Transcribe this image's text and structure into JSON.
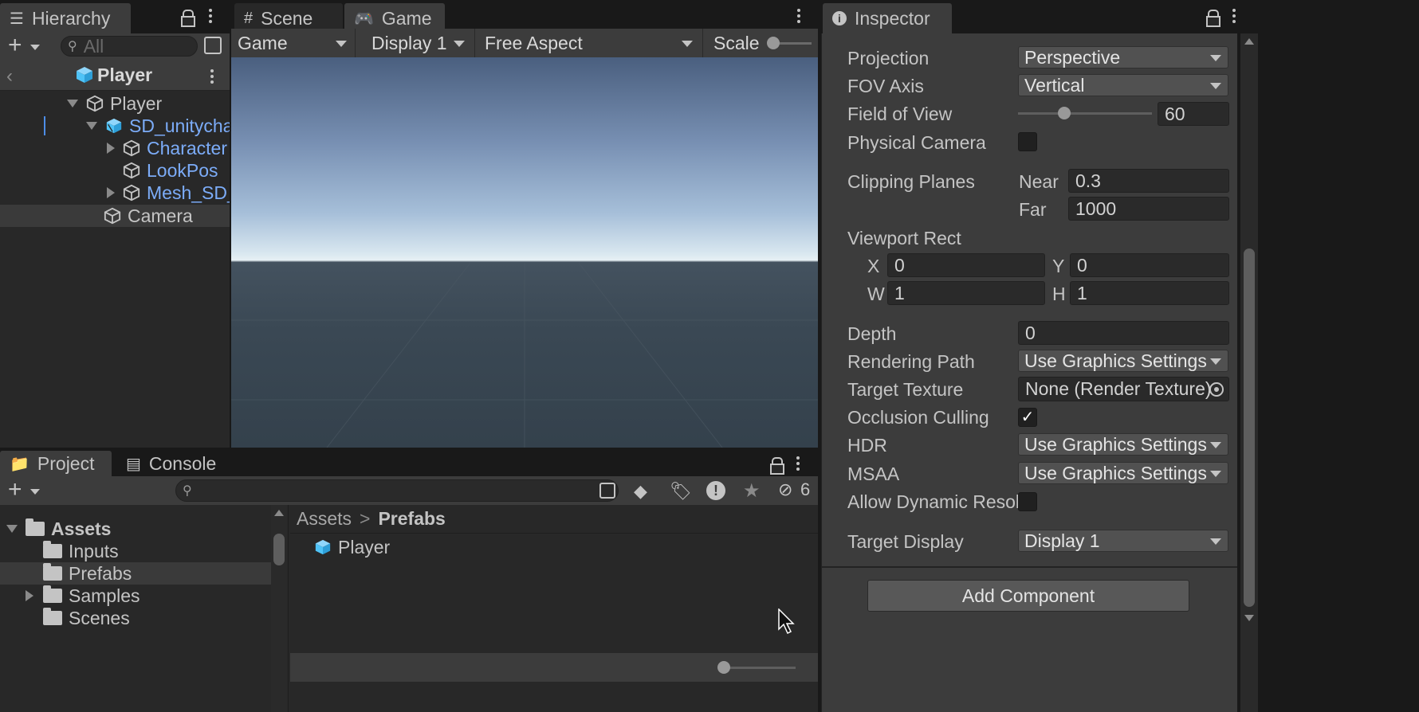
{
  "hierarchy": {
    "tab_label": "Hierarchy",
    "search_placeholder": "All",
    "prefab_header": "Player",
    "items": [
      {
        "label": "Player"
      },
      {
        "label": "SD_unitycha"
      },
      {
        "label": "Character"
      },
      {
        "label": "LookPos"
      },
      {
        "label": "Mesh_SD_"
      },
      {
        "label": "Camera"
      }
    ]
  },
  "game_view": {
    "tabs": [
      {
        "label": "Scene"
      },
      {
        "label": "Game"
      }
    ],
    "toolbar": {
      "mode": "Game",
      "display": "Display 1",
      "aspect": "Free Aspect",
      "scale_label": "Scale"
    }
  },
  "inspector": {
    "tab_label": "Inspector",
    "rows": {
      "projection": {
        "label": "Projection",
        "value": "Perspective"
      },
      "fov_axis": {
        "label": "FOV Axis",
        "value": "Vertical"
      },
      "field_of_view": {
        "label": "Field of View",
        "value": "60"
      },
      "physical_camera": {
        "label": "Physical Camera"
      },
      "clipping_planes": {
        "label": "Clipping Planes",
        "near_label": "Near",
        "near": "0.3",
        "far_label": "Far",
        "far": "1000"
      },
      "viewport_rect": {
        "label": "Viewport Rect",
        "x_label": "X",
        "x": "0",
        "y_label": "Y",
        "y": "0",
        "w_label": "W",
        "w": "1",
        "h_label": "H",
        "h": "1"
      },
      "depth": {
        "label": "Depth",
        "value": "0"
      },
      "rendering_path": {
        "label": "Rendering Path",
        "value": "Use Graphics Settings"
      },
      "target_texture": {
        "label": "Target Texture",
        "value": "None (Render Texture)"
      },
      "occlusion_culling": {
        "label": "Occlusion Culling",
        "check": "✓"
      },
      "hdr": {
        "label": "HDR",
        "value": "Use Graphics Settings"
      },
      "msaa": {
        "label": "MSAA",
        "value": "Use Graphics Settings"
      },
      "allow_dynamic": {
        "label": "Allow Dynamic Resol"
      },
      "target_display": {
        "label": "Target Display",
        "value": "Display 1"
      }
    },
    "add_component": "Add Component"
  },
  "project": {
    "tabs": [
      {
        "label": "Project"
      },
      {
        "label": "Console"
      }
    ],
    "hidden_count": "6",
    "tree": {
      "root": "Assets",
      "children": [
        {
          "label": "Inputs"
        },
        {
          "label": "Prefabs"
        },
        {
          "label": "Samples"
        },
        {
          "label": "Scenes"
        }
      ]
    },
    "breadcrumb": {
      "root": "Assets",
      "separator": ">",
      "current": "Prefabs"
    },
    "assets": [
      {
        "label": "Player"
      }
    ]
  },
  "colors": {
    "accent_blue": "#7cacf8",
    "prefab_cube": "#4fc3f7",
    "panel_bg": "#282828",
    "toolbar_bg": "#3c3c3c"
  }
}
